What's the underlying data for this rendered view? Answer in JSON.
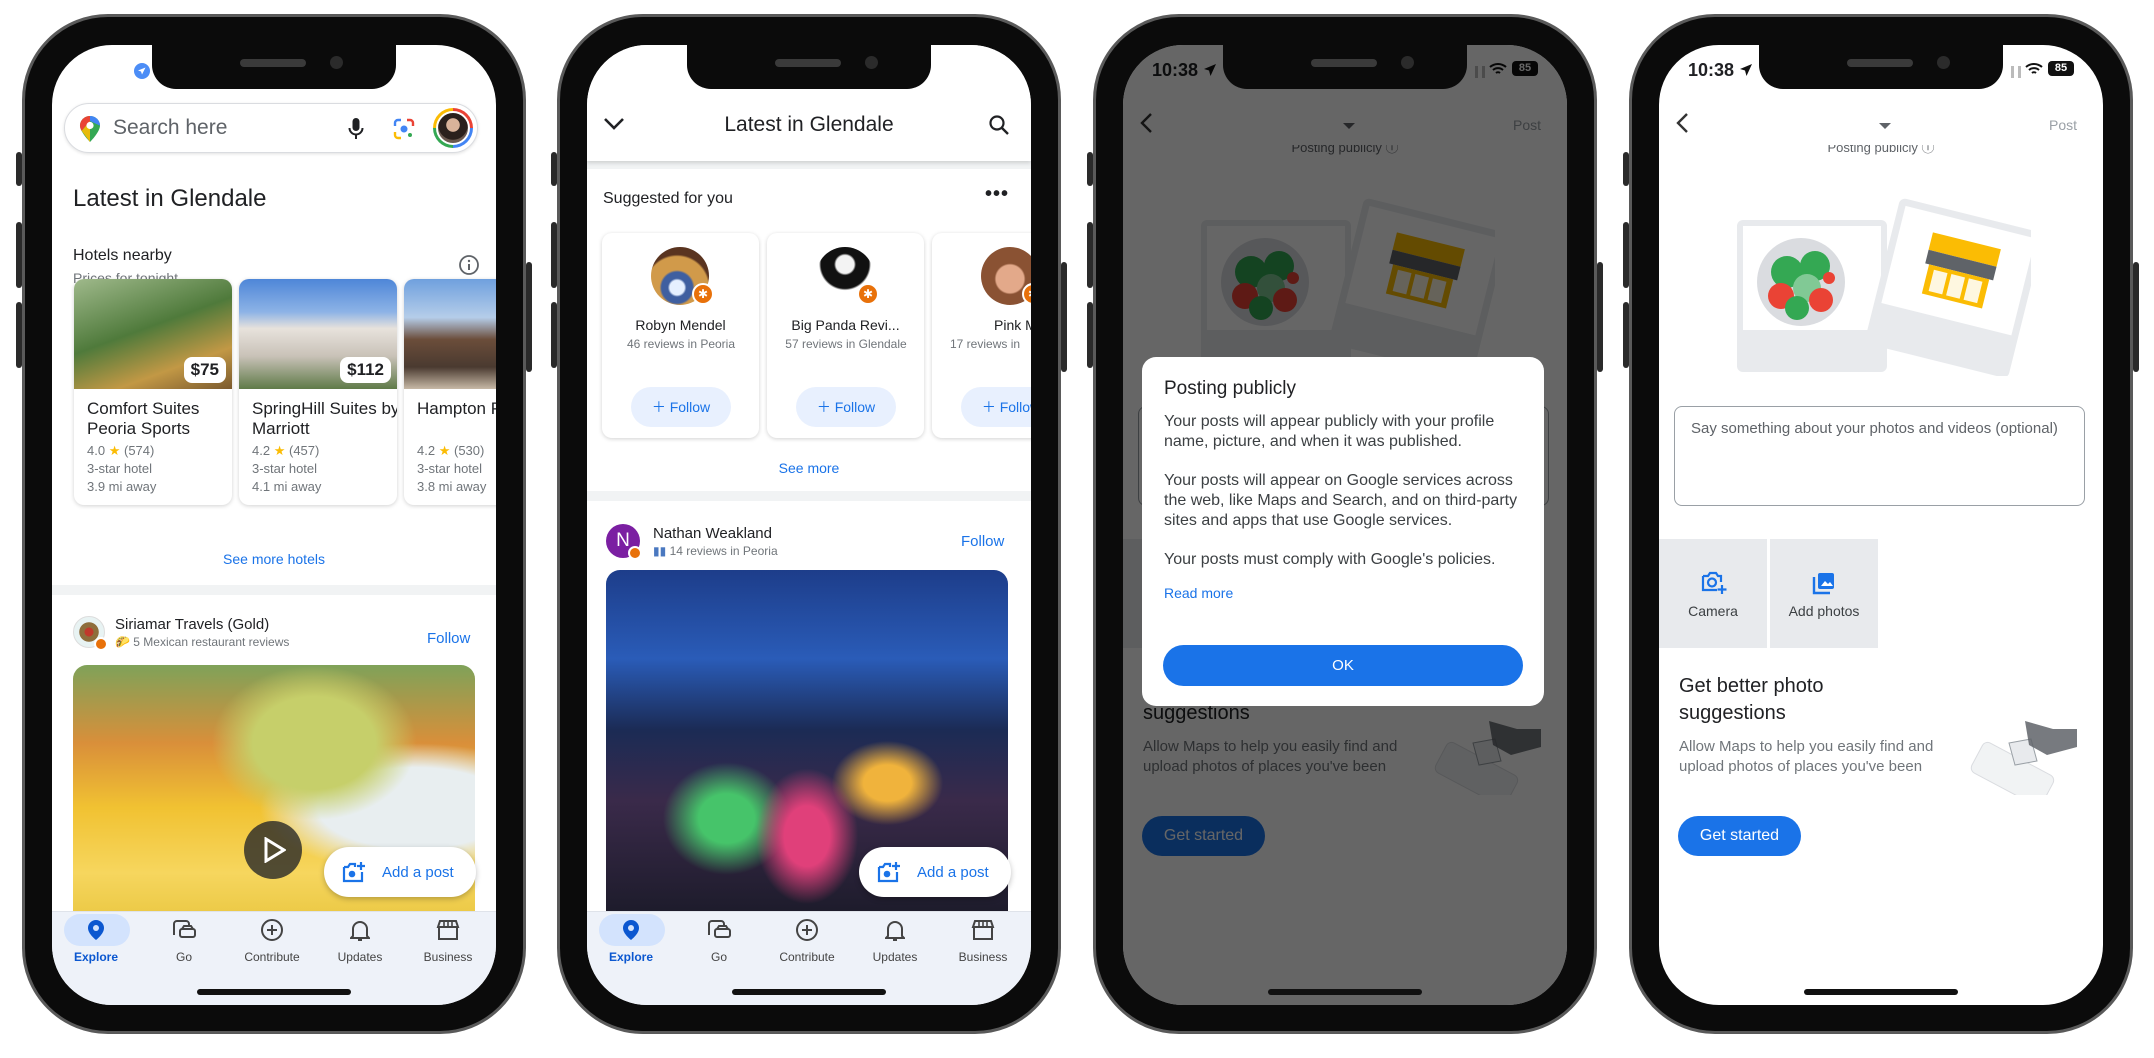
{
  "colors": {
    "accent": "#1a73e8",
    "nav_active_pill": "#d3e3fd",
    "badge_orange": "#e8710a",
    "separator": "#f1f3f4",
    "dim_overlay": "rgba(0,0,0,0.6)"
  },
  "nav": [
    {
      "label": "Explore",
      "icon": "map-pin-icon",
      "active": true
    },
    {
      "label": "Go",
      "icon": "commute-icon"
    },
    {
      "label": "Contribute",
      "icon": "add-circle-icon"
    },
    {
      "label": "Updates",
      "icon": "bell-icon"
    },
    {
      "label": "Business",
      "icon": "storefront-icon"
    }
  ],
  "explore": {
    "search_placeholder": "Search here",
    "title": "Latest in Glendale",
    "hotels": {
      "title": "Hotels nearby",
      "subtitle": "Prices for tonight",
      "items": [
        {
          "name": "Comfort Suites Peoria Sports",
          "price": "$75",
          "rating": "4.0",
          "reviews": "(574)",
          "class": "3-star hotel",
          "distance": "3.9 mi away"
        },
        {
          "name": "SpringHill Suites by Marriott",
          "price": "$112",
          "rating": "4.2",
          "reviews": "(457)",
          "class": "3-star hotel",
          "distance": "4.1 mi away"
        },
        {
          "name": "Hampton Phoenix/",
          "price": "",
          "rating": "4.2",
          "reviews": "(530)",
          "class": "3-star hotel",
          "distance": "3.8 mi away"
        }
      ],
      "see_more": "See more hotels"
    },
    "post": {
      "author": "Siriamar Travels (Gold)",
      "subtitle": "5 Mexican restaurant reviews",
      "follow": "Follow"
    },
    "add_post": "Add a post"
  },
  "feed": {
    "title": "Latest in Glendale",
    "suggested_title": "Suggested for you",
    "suggestions": [
      {
        "name": "Robyn Mendel",
        "reviews": "46 reviews in Peoria",
        "follow": "Follow"
      },
      {
        "name": "Big Panda Revi...",
        "reviews": "57 reviews in Glendale",
        "follow": "Follow"
      },
      {
        "name": "Pink Mo",
        "reviews": "17 reviews in",
        "follow": "Follow"
      }
    ],
    "see_more": "See more",
    "post": {
      "author": "Nathan Weakland",
      "avatar_letter": "N",
      "subtitle": "14 reviews in Peoria",
      "follow": "Follow"
    },
    "add_post": "Add a post"
  },
  "compose": {
    "status": {
      "time": "10:38",
      "battery": "85"
    },
    "post_button": "Post",
    "posting_publicly": "Posting publicly",
    "textarea_placeholder": "Say something about your photos and videos (optional)",
    "camera": "Camera",
    "add_photos": "Add photos",
    "promo_title": "Get better photo suggestions",
    "promo_body": "Allow Maps to help you easily find and upload photos of places you've been",
    "get_started": "Get started"
  },
  "dialog": {
    "title": "Posting publicly",
    "paragraphs": [
      "Your posts will appear publicly with your profile name, picture, and when it was published.",
      "Your posts will appear on Google services across the web, like Maps and Search, and on third-party sites and apps that use Google services.",
      "Your posts must comply with Google's policies."
    ],
    "read_more": "Read more",
    "ok": "OK"
  }
}
